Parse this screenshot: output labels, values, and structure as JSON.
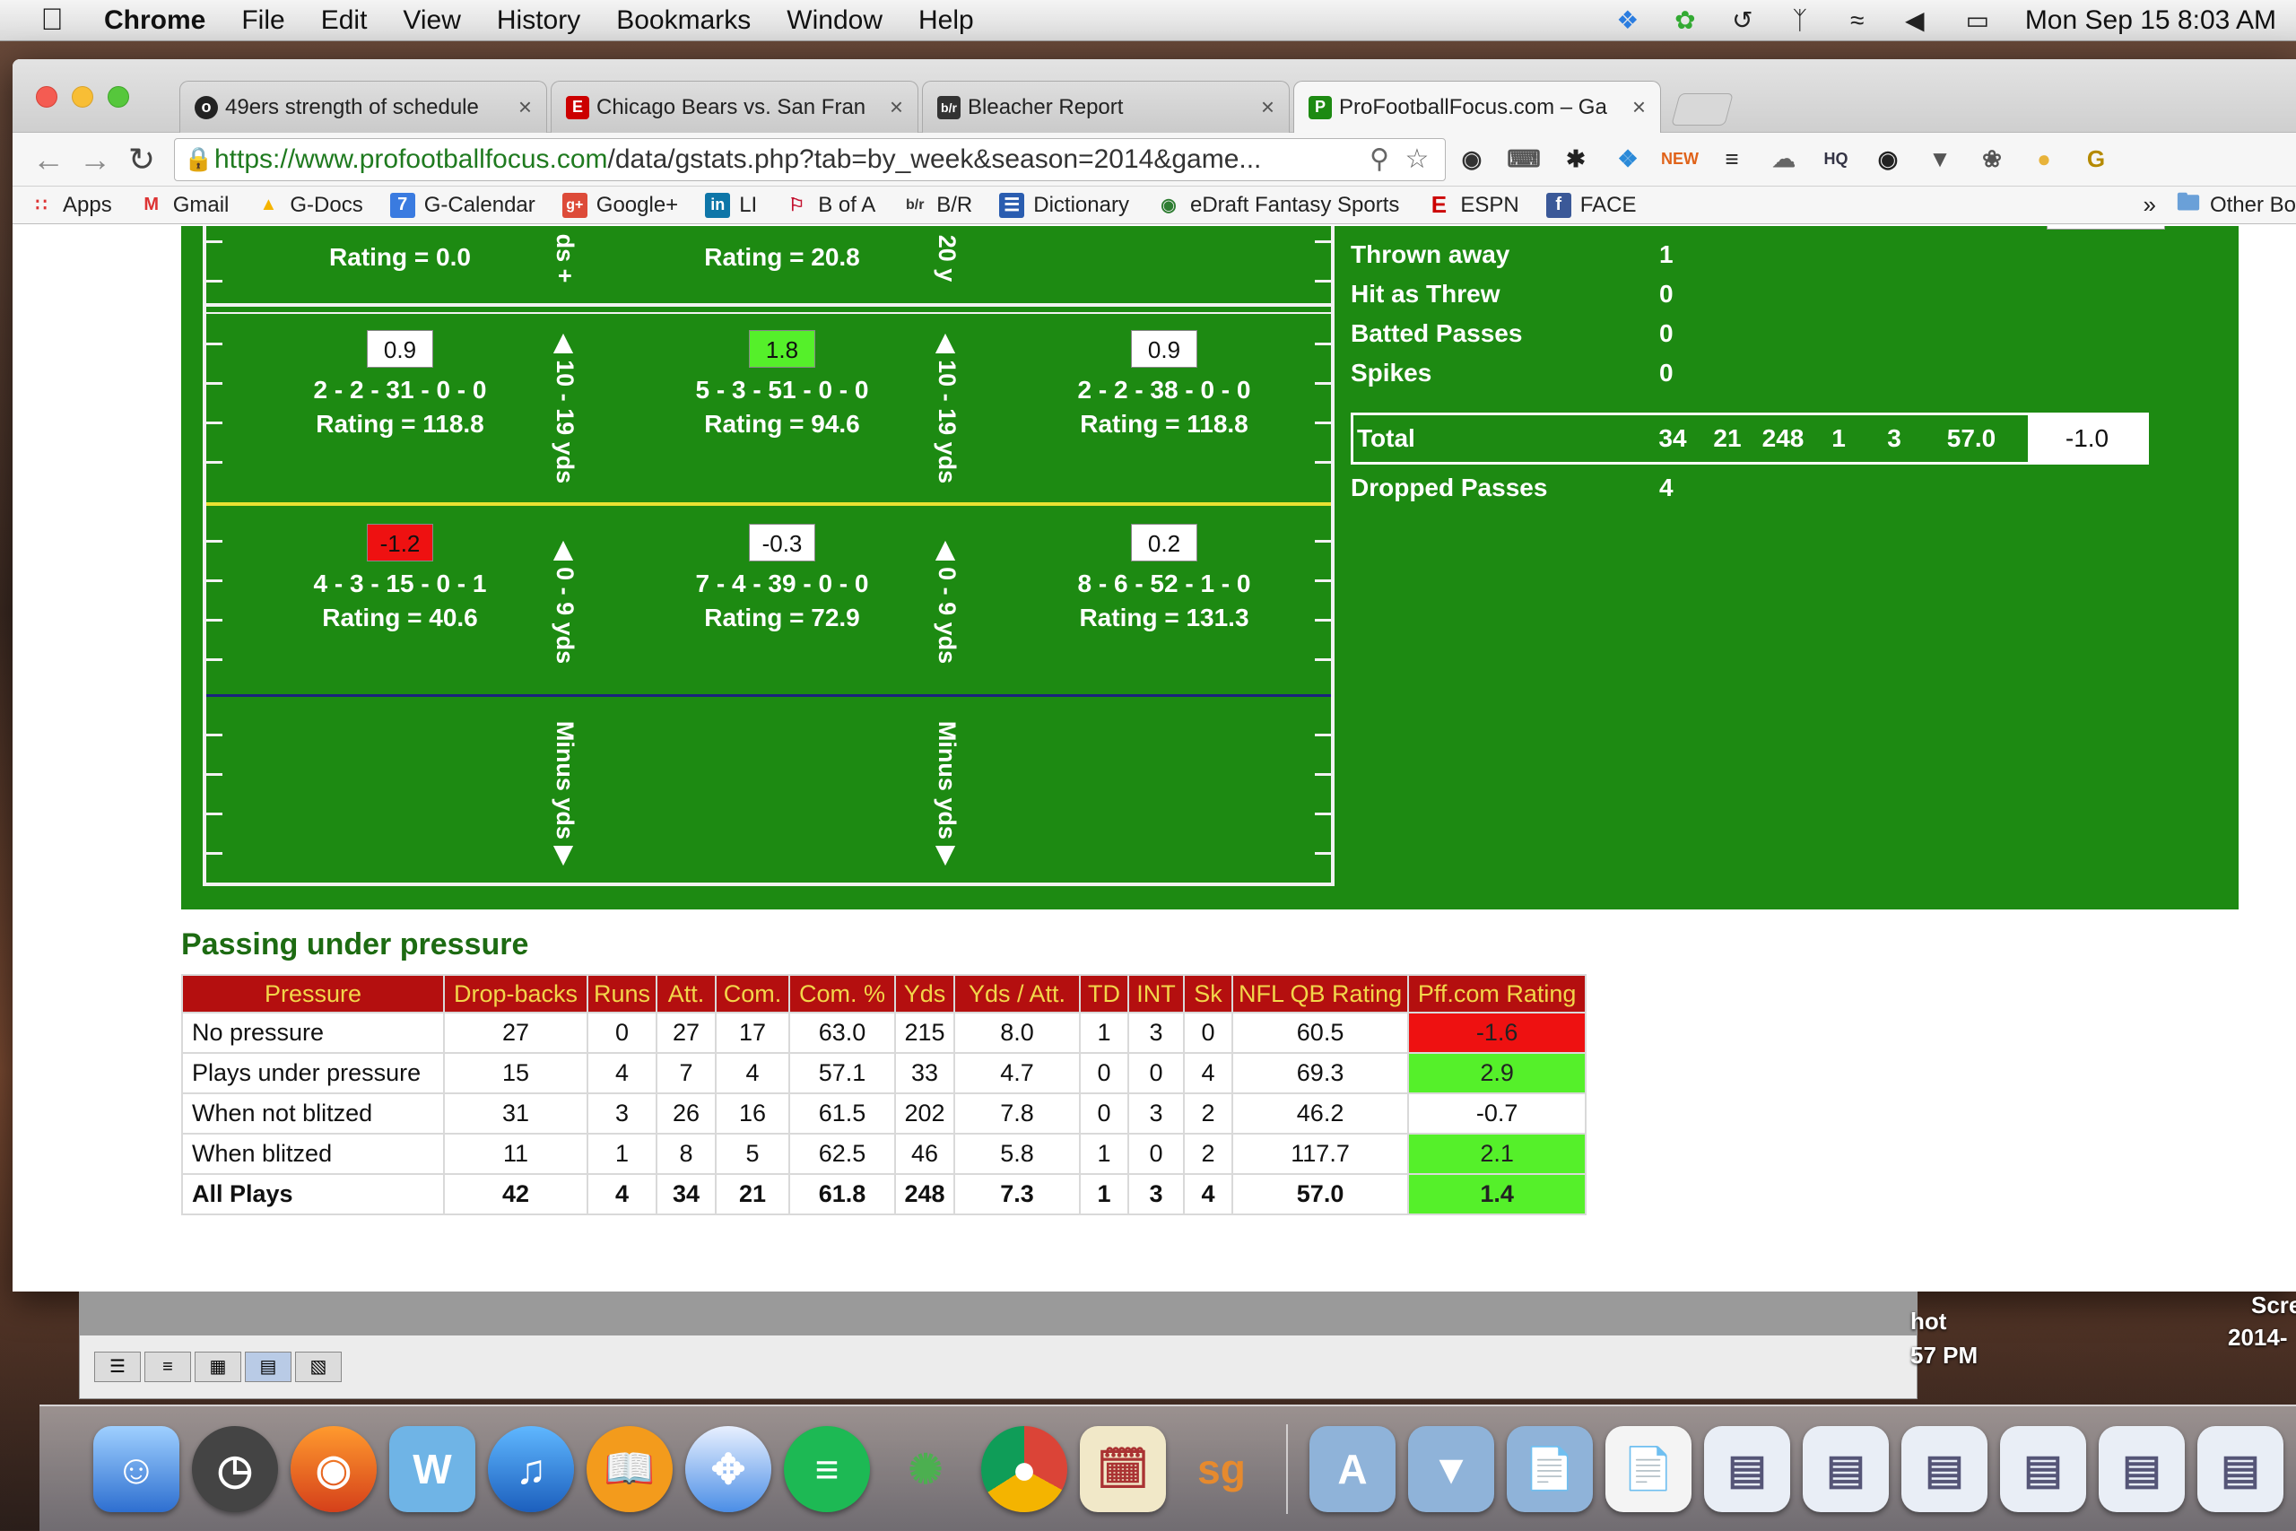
{
  "menubar": {
    "app": "Chrome",
    "menus": [
      "File",
      "Edit",
      "View",
      "History",
      "Bookmarks",
      "Window",
      "Help"
    ],
    "clock": "Mon Sep 15  8:03 AM"
  },
  "tabs": [
    {
      "title": "49ers strength of schedule",
      "favicon": "sb-icon",
      "color": "#222222"
    },
    {
      "title": "Chicago Bears vs. San Fran",
      "favicon": "espn-icon",
      "color": "#cc0000"
    },
    {
      "title": "Bleacher Report",
      "favicon": "br-icon",
      "color": "#333333"
    },
    {
      "title": "ProFootballFocus.com – Ga",
      "favicon": "pff-icon",
      "color": "#1d8a12"
    }
  ],
  "toolbar": {
    "url_host": "https://www.profootballfocus.com",
    "url_rest": "/data/gstats.php?tab=by_week&season=2014&game..."
  },
  "bookmarks": [
    {
      "label": "Apps",
      "icon": "apps-grid-icon",
      "color": "#d33"
    },
    {
      "label": "Gmail",
      "icon": "gmail-icon",
      "color": "#d33"
    },
    {
      "label": "G-Docs",
      "icon": "drive-icon",
      "color": "#f5b400"
    },
    {
      "label": "G-Calendar",
      "icon": "calendar-icon",
      "color": "#3a7be0"
    },
    {
      "label": "Google+",
      "icon": "google-plus-icon",
      "color": "#dd4b39"
    },
    {
      "label": "LI",
      "icon": "linkedin-icon",
      "color": "#0e76a8"
    },
    {
      "label": "B of A",
      "icon": "bofa-icon",
      "color": "#c41230"
    },
    {
      "label": "B/R",
      "icon": "br-icon",
      "color": "#333333"
    },
    {
      "label": "Dictionary",
      "icon": "dictionary-icon",
      "color": "#2a5db0"
    },
    {
      "label": "eDraft Fantasy Sports",
      "icon": "edraft-icon",
      "color": "#2e7d32"
    },
    {
      "label": "ESPN",
      "icon": "espn-icon",
      "color": "#cc0000"
    },
    {
      "label": "FACE",
      "icon": "facebook-icon",
      "color": "#3b5998"
    },
    {
      "label": "Other Bo",
      "icon": "folder-icon",
      "color": "#6aa0d8"
    }
  ],
  "field": {
    "top_row": {
      "left": "Rating = 0.0",
      "mid_label": "ds +",
      "center": "Rating = 20.8",
      "right_label": "20 y"
    },
    "rows": [
      {
        "left_label": "10 - 19 yds",
        "right_label": "10 - 19 yds",
        "cells": [
          {
            "score": "0.9",
            "line": "2 - 2 - 31 - 0 - 0",
            "rating": "Rating = 118.8",
            "tone": "neutral"
          },
          {
            "score": "1.8",
            "line": "5 - 3 - 51 - 0 - 0",
            "rating": "Rating = 94.6",
            "tone": "pos"
          },
          {
            "score": "0.9",
            "line": "2 - 2 - 38 - 0 - 0",
            "rating": "Rating = 118.8",
            "tone": "neutral"
          }
        ]
      },
      {
        "left_label": "0 - 9 yds",
        "right_label": "0 - 9 yds",
        "cells": [
          {
            "score": "-1.2",
            "line": "4 - 3 - 15 - 0 - 1",
            "rating": "Rating = 40.6",
            "tone": "neg"
          },
          {
            "score": "-0.3",
            "line": "7 - 4 - 39 - 0 - 0",
            "rating": "Rating = 72.9",
            "tone": "neutral"
          },
          {
            "score": "0.2",
            "line": "8 - 6 - 52 - 1 - 0",
            "rating": "Rating = 131.3",
            "tone": "neutral"
          }
        ]
      }
    ],
    "minus_label": "Minus yds"
  },
  "side_stats": {
    "rows": [
      {
        "label": "Thrown away",
        "value": "1"
      },
      {
        "label": "Hit as Threw",
        "value": "0"
      },
      {
        "label": "Batted Passes",
        "value": "0"
      },
      {
        "label": "Spikes",
        "value": "0"
      }
    ],
    "total": {
      "label": "Total",
      "values": [
        "34",
        "21",
        "248",
        "1",
        "3",
        "57.0"
      ],
      "rating": "-1.0"
    },
    "dropped": {
      "label": "Dropped Passes",
      "value": "4"
    }
  },
  "pressure": {
    "title": "Passing under pressure",
    "headers": [
      "Pressure",
      "Drop-backs",
      "Runs",
      "Att.",
      "Com.",
      "Com. %",
      "Yds",
      "Yds / Att.",
      "TD",
      "INT",
      "Sk",
      "NFL QB Rating",
      "Pff.com Rating"
    ],
    "rows": [
      {
        "cells": [
          "No pressure",
          "27",
          "0",
          "27",
          "17",
          "63.0",
          "215",
          "8.0",
          "1",
          "3",
          "0",
          "60.5",
          "-1.6"
        ],
        "tone": "neg",
        "bold": false
      },
      {
        "cells": [
          "Plays under pressure",
          "15",
          "4",
          "7",
          "4",
          "57.1",
          "33",
          "4.7",
          "0",
          "0",
          "4",
          "69.3",
          "2.9"
        ],
        "tone": "pos",
        "bold": false
      },
      {
        "cells": [
          "When not blitzed",
          "31",
          "3",
          "26",
          "16",
          "61.5",
          "202",
          "7.8",
          "0",
          "3",
          "2",
          "46.2",
          "-0.7"
        ],
        "tone": "neutral",
        "bold": false
      },
      {
        "cells": [
          "When blitzed",
          "11",
          "1",
          "8",
          "5",
          "62.5",
          "46",
          "5.8",
          "1",
          "0",
          "2",
          "117.7",
          "2.1"
        ],
        "tone": "pos",
        "bold": false
      },
      {
        "cells": [
          "All Plays",
          "42",
          "4",
          "34",
          "21",
          "61.8",
          "248",
          "7.3",
          "1",
          "3",
          "4",
          "57.0",
          "1.4"
        ],
        "tone": "pos",
        "bold": true
      }
    ]
  },
  "desktop": {
    "label_a": "hot",
    "label_b": "57 PM",
    "label_c": "Scre",
    "label_d": "2014-"
  }
}
